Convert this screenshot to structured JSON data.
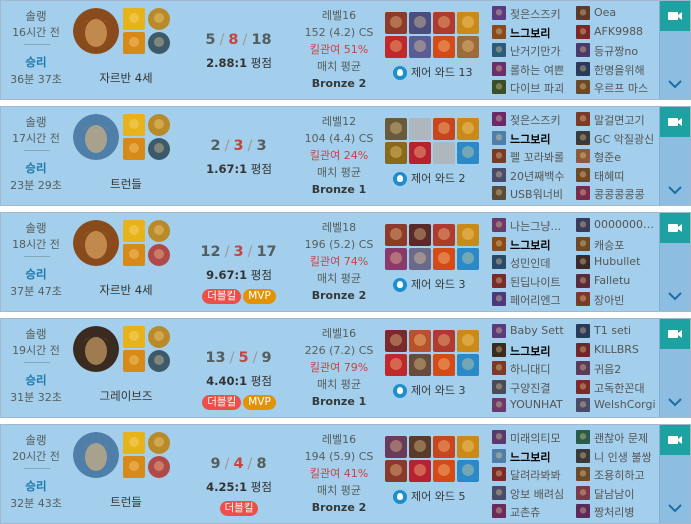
{
  "labels": {
    "cs_suffix": "CS",
    "kp_prefix": "킬관여",
    "match_avg": "매치 평균",
    "ratio_suffix": "평점",
    "ward_prefix": "제어 와드"
  },
  "colors": {
    "win_bg": "#a3cfec",
    "accent_win": "#1a78ae",
    "death": "#c6443e",
    "double_kill": "#ec4f48",
    "mvp": "#e19205",
    "replay": "#1ea1a1"
  },
  "matches": [
    {
      "type": "솔랭",
      "ago": "16시간 전",
      "result": "승리",
      "duration": "36분 37초",
      "champion": "자르반 4세",
      "portrait_hue": "#8a4b1c",
      "spells": [
        "flash-spell-icon",
        "smite-spell-icon"
      ],
      "runes": [
        "conqueror-rune-icon",
        "resolve-rune-icon"
      ],
      "kills": "5",
      "deaths": "8",
      "assists": "18",
      "ratio": "2.88:1",
      "badges": [],
      "level": "레벨16",
      "cs": "152 (4.2) CS",
      "kp": "51%",
      "tier": "Bronze 2",
      "wards": "13",
      "items": [
        "#8d3a2a",
        "#4a4d7e",
        "#b03a2e",
        "#c0282a",
        "#5a5c96",
        "#d44b18",
        "#9c6b3a"
      ],
      "blue": [
        {
          "n": "젖은스즈키",
          "c": "#5a3b82"
        },
        {
          "n": "느그보리",
          "c": "#8a4b1c",
          "me": true
        },
        {
          "n": "난거기만가",
          "c": "#2c5c7a"
        },
        {
          "n": "롤하는 여쁜",
          "c": "#6b2f6b"
        },
        {
          "n": "다이브 파괴",
          "c": "#3a4e2a"
        }
      ],
      "red": [
        {
          "n": "Oea",
          "c": "#5b3a2a"
        },
        {
          "n": "AFK9988",
          "c": "#7a2828"
        },
        {
          "n": "등규짱no",
          "c": "#4a3a6b"
        },
        {
          "n": "한명을위해",
          "c": "#2c3a5a"
        },
        {
          "n": "우르프 마스",
          "c": "#6b4a2a"
        }
      ]
    },
    {
      "type": "솔랭",
      "ago": "17시간 전",
      "result": "승리",
      "duration": "23분 29초",
      "champion": "트런들",
      "portrait_hue": "#4f7fa8",
      "spells": [
        "flash-spell-icon",
        "smite-spell-icon"
      ],
      "runes": [
        "conqueror-rune-icon",
        "resolve-rune-icon"
      ],
      "kills": "2",
      "deaths": "3",
      "assists": "3",
      "ratio": "1.67:1",
      "badges": [],
      "level": "레벨12",
      "cs": "104 (4.4) CS",
      "kp": "24%",
      "tier": "Bronze 1",
      "wards": "2",
      "items": [
        "#6a5a3a",
        "",
        "#c8461e",
        "#8a6a18",
        "#b8222e",
        "",
        "#2a8ac8"
      ],
      "blue": [
        {
          "n": "젖은스즈키",
          "c": "#6a2a6a"
        },
        {
          "n": "느그보리",
          "c": "#4f7fa8",
          "me": true
        },
        {
          "n": "펠 꼬라봐롤",
          "c": "#7a3a2a"
        },
        {
          "n": "20년째백수",
          "c": "#4a4a6a"
        },
        {
          "n": "USB워너비",
          "c": "#5a4a3a"
        }
      ],
      "red": [
        {
          "n": "말걸면고기",
          "c": "#7a3a2a"
        },
        {
          "n": "GC 악질광신",
          "c": "#3a3a3a"
        },
        {
          "n": "형준e",
          "c": "#8a5a3a"
        },
        {
          "n": "태혜띠",
          "c": "#6a4a2a"
        },
        {
          "n": "콩콩콩콩콩",
          "c": "#7a2a4a"
        }
      ]
    },
    {
      "type": "솔랭",
      "ago": "18시간 전",
      "result": "승리",
      "duration": "37분 47초",
      "champion": "자르반 4세",
      "portrait_hue": "#8a4b1c",
      "spells": [
        "flash-spell-icon",
        "smite-spell-icon"
      ],
      "runes": [
        "conqueror-rune-icon",
        "domination-rune-icon"
      ],
      "kills": "12",
      "deaths": "3",
      "assists": "17",
      "ratio": "9.67:1",
      "badges": [
        "더블킬",
        "MVP"
      ],
      "level": "레벨18",
      "cs": "196 (5.2) CS",
      "kp": "74%",
      "tier": "Bronze 2",
      "wards": "3",
      "items": [
        "#8d3a2a",
        "#5a2a2a",
        "#b03a2e",
        "#8a3a6a",
        "#6a6a8a",
        "#d44b18",
        "#2a8ac8"
      ],
      "blue": [
        {
          "n": "나는그냥...",
          "c": "#6a3a6a"
        },
        {
          "n": "느그보리",
          "c": "#8a4b1c",
          "me": true
        },
        {
          "n": "성민인데",
          "c": "#2a4a6a"
        },
        {
          "n": "된딥나이트",
          "c": "#7a2a2a"
        },
        {
          "n": "페어리엔그",
          "c": "#4a3a7a"
        }
      ],
      "red": [
        {
          "n": "0000000o00",
          "c": "#3a3a5a"
        },
        {
          "n": "캐승포",
          "c": "#6a4a2a"
        },
        {
          "n": "Hubullet",
          "c": "#3a2a2a"
        },
        {
          "n": "Falletu",
          "c": "#5a2a3a"
        },
        {
          "n": "장아빈",
          "c": "#7a3a2a"
        }
      ]
    },
    {
      "type": "솔랭",
      "ago": "19시간 전",
      "result": "승리",
      "duration": "31분 32초",
      "champion": "그레이브즈",
      "portrait_hue": "#3b2a1f",
      "spells": [
        "flash-spell-icon",
        "smite-spell-icon"
      ],
      "runes": [
        "conqueror-rune-icon",
        "resolve-rune-icon"
      ],
      "kills": "13",
      "deaths": "5",
      "assists": "9",
      "ratio": "4.40:1",
      "badges": [
        "더블킬",
        "MVP"
      ],
      "level": "레벨16",
      "cs": "226 (7.2) CS",
      "kp": "79%",
      "tier": "Bronze 1",
      "wards": "3",
      "items": [
        "#7a2a2a",
        "#b8522a",
        "#b03a2e",
        "#c0282a",
        "#6a4a3a",
        "#d44b18",
        "#2a8ac8"
      ],
      "blue": [
        {
          "n": "Baby Sett",
          "c": "#5a3a7a"
        },
        {
          "n": "느그보리",
          "c": "#3b2a1f",
          "me": true
        },
        {
          "n": "하니대디",
          "c": "#7a3a2a"
        },
        {
          "n": "구양진결",
          "c": "#4a4a5a"
        },
        {
          "n": "YOUNHAT",
          "c": "#6a3a6a"
        }
      ],
      "red": [
        {
          "n": "T1 seti",
          "c": "#2a3a5a"
        },
        {
          "n": "KILLBRS",
          "c": "#6a2a2a"
        },
        {
          "n": "귀음2",
          "c": "#5a3a5a"
        },
        {
          "n": "고독한꼰대",
          "c": "#7a2a2a"
        },
        {
          "n": "WelshCorgi",
          "c": "#4a4a6a"
        }
      ]
    },
    {
      "type": "솔랭",
      "ago": "20시간 전",
      "result": "승리",
      "duration": "32분 43초",
      "champion": "트런들",
      "portrait_hue": "#4f7fa8",
      "spells": [
        "flash-spell-icon",
        "smite-spell-icon"
      ],
      "runes": [
        "conqueror-rune-icon",
        "domination-rune-icon"
      ],
      "kills": "9",
      "deaths": "4",
      "assists": "8",
      "ratio": "4.25:1",
      "badges": [
        "더블킬"
      ],
      "level": "레벨16",
      "cs": "194 (5.9) CS",
      "kp": "41%",
      "tier": "Bronze 2",
      "wards": "5",
      "items": [
        "#6a3a5a",
        "#5a3a2a",
        "#c8461e",
        "#8a3a2a",
        "#b8222e",
        "#d44b18",
        "#2a8ac8"
      ],
      "blue": [
        {
          "n": "미래의티모",
          "c": "#5a3a6a"
        },
        {
          "n": "느그보리",
          "c": "#4f7fa8",
          "me": true
        },
        {
          "n": "달려라봐봐",
          "c": "#7a2a2a"
        },
        {
          "n": "앙보 배려심",
          "c": "#4a4a6a"
        },
        {
          "n": "교촌츄",
          "c": "#6a2a5a"
        }
      ],
      "red": [
        {
          "n": "괜찮아 문제",
          "c": "#2a5a4a"
        },
        {
          "n": "니 인생 불쌍",
          "c": "#3a3a3a"
        },
        {
          "n": "조용히하고",
          "c": "#6a4a2a"
        },
        {
          "n": "달남남이",
          "c": "#7a3a4a"
        },
        {
          "n": "짱처리병",
          "c": "#5a2a5a"
        }
      ]
    }
  ]
}
